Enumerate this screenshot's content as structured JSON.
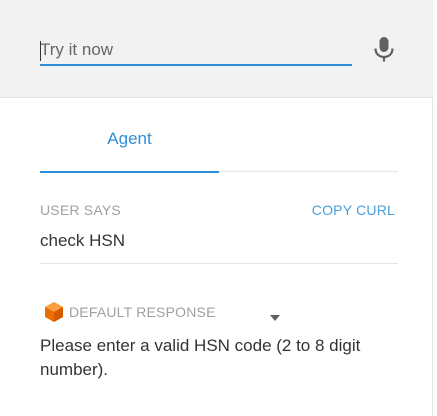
{
  "try_it": {
    "placeholder": "Try it now",
    "mic_icon": "microphone-icon"
  },
  "tabs": [
    {
      "label": "Agent",
      "active": true
    }
  ],
  "result": {
    "user_says_label": "USER SAYS",
    "copy_curl_label": "COPY CURL",
    "query": "check HSN",
    "response_label": "DEFAULT RESPONSE",
    "response_icon": "dialogflow-icon",
    "response_text": "Please enter a valid HSN code (2 to 8 digit number)."
  },
  "colors": {
    "accent": "#2e8fd8",
    "icon_orange": "#ef6c00",
    "muted_text": "#a0a0a0",
    "header_bg": "#f2f2f2"
  }
}
